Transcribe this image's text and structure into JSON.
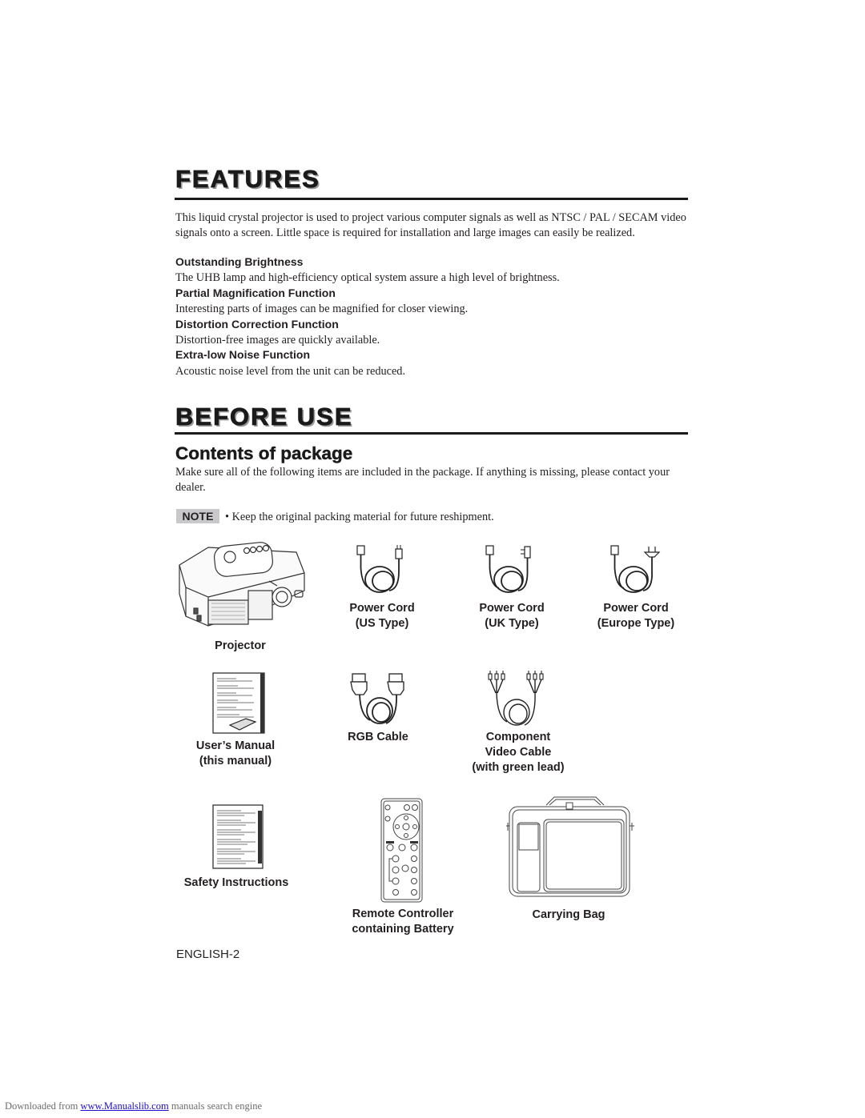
{
  "features": {
    "heading": "FEATURES",
    "intro": "This liquid crystal projector is used to project various computer signals as well as NTSC / PAL / SECAM video signals onto a screen. Little space is required for installation and large images can easily be realized.",
    "items": [
      {
        "title": "Outstanding Brightness",
        "text": "The UHB lamp and high-efficiency optical system assure a high level of brightness."
      },
      {
        "title": "Partial Magnification Function",
        "text": "Interesting parts of images can be magnified for closer viewing."
      },
      {
        "title": "Distortion Correction Function",
        "text": "Distortion-free images are quickly available."
      },
      {
        "title": "Extra-low Noise Function",
        "text": "Acoustic noise level from the unit can be reduced."
      }
    ]
  },
  "before_use": {
    "heading": "BEFORE USE",
    "subheading": "Contents of package",
    "intro": "Make sure all of the following items are included in the package. If anything is missing, please contact your dealer.",
    "note": {
      "badge": "NOTE",
      "text": "• Keep the original packing material for future reshipment."
    },
    "package_items": [
      {
        "icon": "projector-icon",
        "label_lines": [
          "Projector"
        ]
      },
      {
        "icon": "power-cord-us-icon",
        "label_lines": [
          "Power Cord",
          "(US Type)"
        ]
      },
      {
        "icon": "power-cord-uk-icon",
        "label_lines": [
          "Power Cord",
          "(UK Type)"
        ]
      },
      {
        "icon": "power-cord-europe-icon",
        "label_lines": [
          "Power Cord",
          "(Europe Type)"
        ]
      },
      {
        "icon": "manual-icon",
        "label_lines": [
          "User’s Manual",
          "(this manual)"
        ]
      },
      {
        "icon": "rgb-cable-icon",
        "label_lines": [
          "RGB Cable"
        ]
      },
      {
        "icon": "component-cable-icon",
        "label_lines": [
          "Component",
          "Video Cable",
          "(with green lead)"
        ]
      },
      {
        "icon": "safety-instructions-icon",
        "label_lines": [
          "Safety Instructions"
        ]
      },
      {
        "icon": "remote-controller-icon",
        "label_lines": [
          "Remote Controller",
          "containing Battery"
        ]
      },
      {
        "icon": "carrying-bag-icon",
        "label_lines": [
          "Carrying Bag"
        ]
      }
    ]
  },
  "page_number": "ENGLISH-2",
  "footer": {
    "prefix": "Downloaded from ",
    "link_text": "www.Manualslib.com",
    "suffix": " manuals search engine",
    "link_color": "#1a0dcc"
  }
}
